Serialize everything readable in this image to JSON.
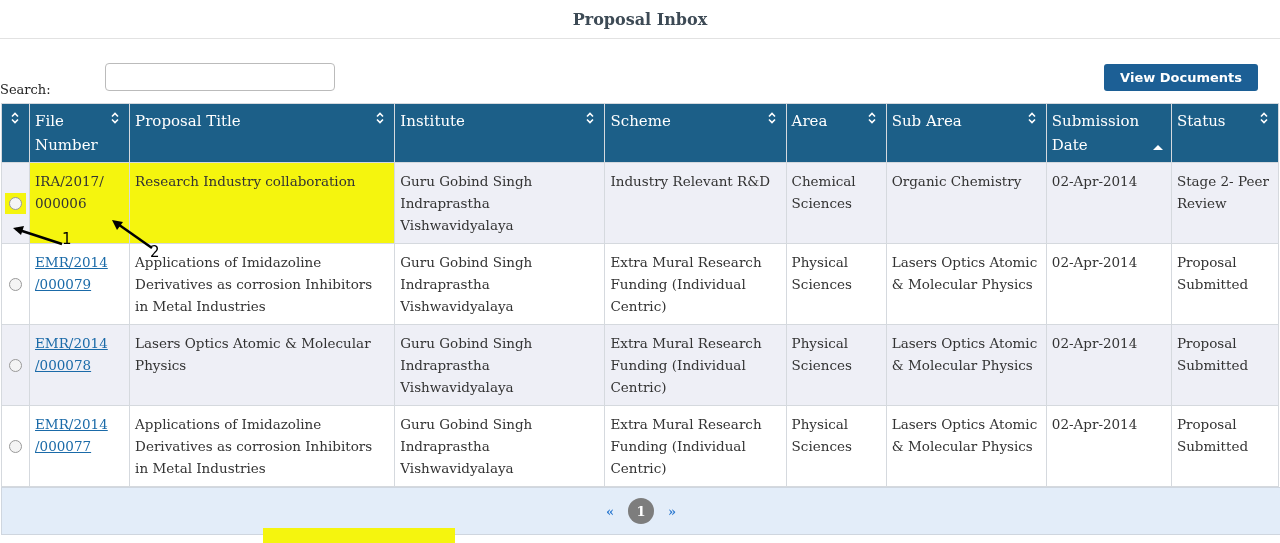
{
  "title": "Proposal Inbox",
  "search": {
    "label": "Search:"
  },
  "view_button": "View Documents",
  "table": {
    "columns": [
      {
        "sorted_ascending": false
      },
      {
        "label": "File Number",
        "sorted_ascending": false
      },
      {
        "label": "Proposal Title",
        "sorted_ascending": false
      },
      {
        "label": "Institute",
        "sorted_ascending": false
      },
      {
        "label": "Scheme",
        "sorted_ascending": false
      },
      {
        "label": "Area",
        "sorted_ascending": false
      },
      {
        "label": "Sub Area",
        "sorted_ascending": false
      },
      {
        "label": "Submission Date",
        "sorted_ascending": true
      },
      {
        "label": "Status",
        "sorted_ascending": false
      }
    ],
    "rows": [
      {
        "selected": false,
        "highlighted": true,
        "file_link": false,
        "file_number": "IRA/2017/ 000006",
        "title": "Research Industry collaboration",
        "institute": "Guru Gobind Singh Indraprastha Vishwavidyalaya",
        "scheme": "Industry Relevant R&D",
        "area": "Chemical Sciences",
        "sub_area": "Organic Chemistry",
        "date": "02-Apr-2014",
        "status": "Stage 2- Peer Review"
      },
      {
        "selected": false,
        "highlighted": false,
        "file_link": true,
        "file_number": "EMR/2014 /000079",
        "title": "Applications of Imidazoline Derivatives as corrosion Inhibitors in Metal Industries",
        "institute": "Guru Gobind Singh Indraprastha Vishwavidyalaya",
        "scheme": "Extra Mural Research Funding (Individual Centric)",
        "area": "Physical Sciences",
        "sub_area": "Lasers Optics Atomic & Molecular Physics",
        "date": "02-Apr-2014",
        "status": "Proposal Submitted"
      },
      {
        "selected": false,
        "highlighted": false,
        "file_link": true,
        "file_number": "EMR/2014 /000078",
        "title": "Lasers Optics Atomic & Molecular Physics",
        "institute": "Guru Gobind Singh Indraprastha Vishwavidyalaya",
        "scheme": "Extra Mural Research Funding (Individual Centric)",
        "area": "Physical Sciences",
        "sub_area": "Lasers Optics Atomic & Molecular Physics",
        "date": "02-Apr-2014",
        "status": "Proposal Submitted"
      },
      {
        "selected": false,
        "highlighted": false,
        "file_link": true,
        "file_number": "EMR/2014 /000077",
        "title": "Applications of Imidazoline Derivatives as corrosion Inhibitors in Metal Industries",
        "institute": "Guru Gobind Singh Indraprastha Vishwavidyalaya",
        "scheme": "Extra Mural Research Funding (Individual Centric)",
        "area": "Physical Sciences",
        "sub_area": "Lasers Optics Atomic & Molecular Physics",
        "date": "02-Apr-2014",
        "status": "Proposal Submitted"
      }
    ]
  },
  "pagination": {
    "prev": "«",
    "pages": [
      {
        "label": "1",
        "selected": true
      }
    ],
    "next": "»"
  },
  "annotations": [
    {
      "label": "1"
    },
    {
      "label": "2"
    }
  ]
}
